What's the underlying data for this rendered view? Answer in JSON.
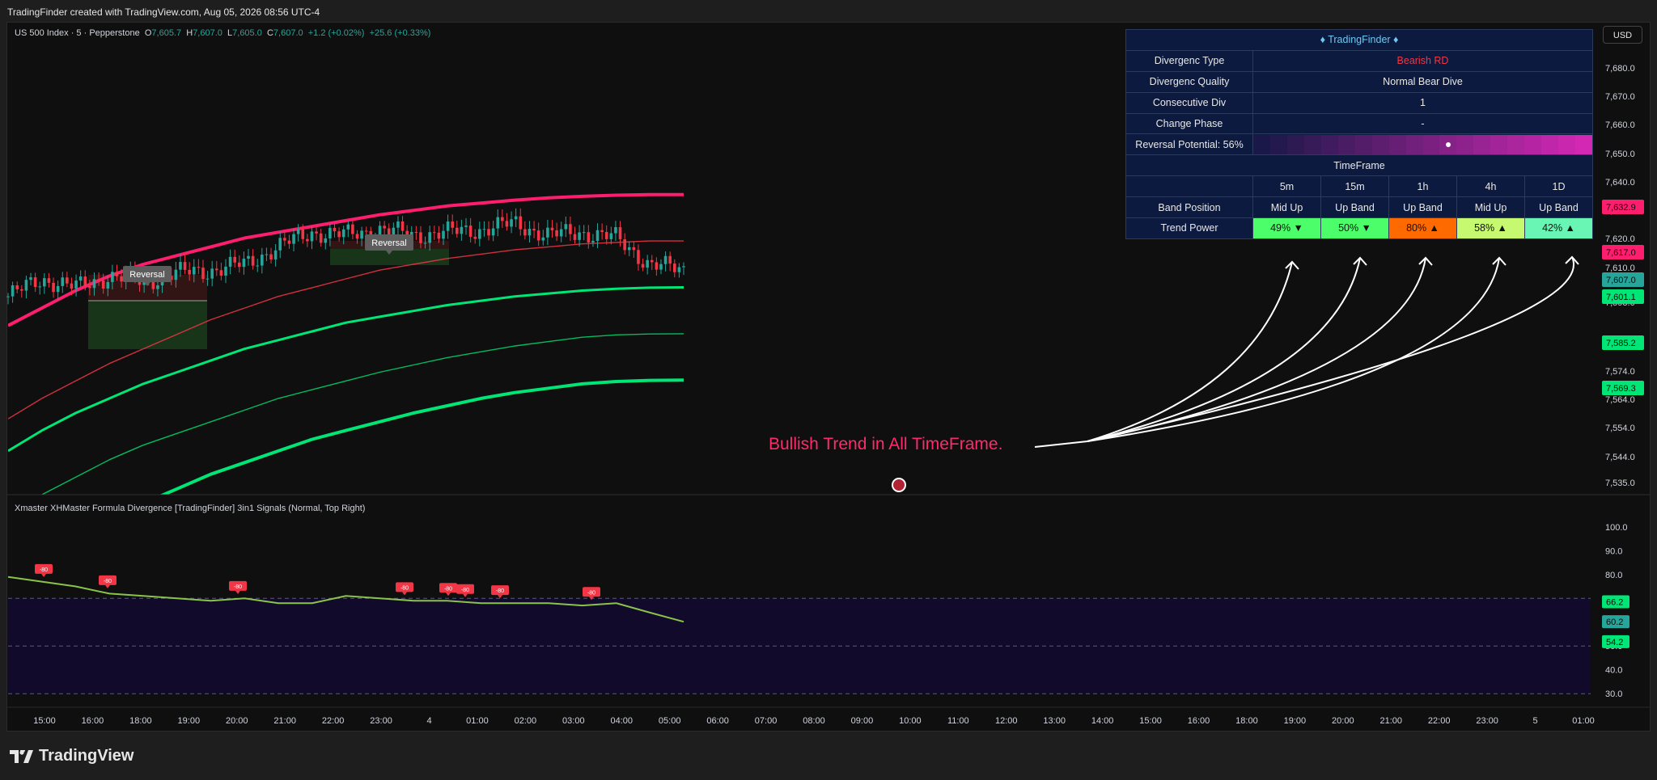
{
  "top_text": "TradingFinder created with TradingView.com, Aug 05, 2026 08:56 UTC-4",
  "brand": "TradingView",
  "currency_button": "USD",
  "symbol_header": {
    "name": "US 500 Index · 5 · Pepperstone",
    "o_label": "O",
    "o": "7,605.7",
    "h_label": "H",
    "h": "7,607.0",
    "l_label": "L",
    "l": "7,605.0",
    "c_label": "C",
    "c": "7,607.0",
    "change": "+1.2 (+0.02%)",
    "change2": "+25.6 (+0.33%)"
  },
  "indicator_header": "Xmaster XHMaster Formula Divergence [TradingFinder] 3in1 Signals (Normal, Top Right)",
  "annotation": "Bullish Trend in All TimeFrame.",
  "reversal_label": "Reversal",
  "signal_badge": "-80",
  "colors": {
    "bull": "#00e676",
    "bear": "#f23645",
    "pink": "#ff1e6e",
    "annotation": "#ff2a6e",
    "panel_bg": "#0c1a3f",
    "osc_zone": "#120a2a"
  },
  "table": {
    "title": "♦ TradingFinder ♦",
    "rows": [
      {
        "label": "Divergenc Type",
        "value": "Bearish RD",
        "value_color": "#f23645"
      },
      {
        "label": "Divergenc Quality",
        "value": "Normal Bear Dive"
      },
      {
        "label": "Consecutive Div",
        "value": "1"
      },
      {
        "label": "Change Phase",
        "value": "-"
      }
    ],
    "reversal_potential": {
      "label": "Reversal Potential: 56%",
      "value": 56
    },
    "timeframe_label": "TimeFrame",
    "timeframes": [
      "5m",
      "15m",
      "1h",
      "4h",
      "1D"
    ],
    "band_position": {
      "label": "Band Position",
      "values": [
        "Mid Up",
        "Up Band",
        "Up Band",
        "Mid Up",
        "Up Band"
      ]
    },
    "trend_power": {
      "label": "Trend Power",
      "values": [
        "49% ▼",
        "50% ▼",
        "80% ▲",
        "58% ▲",
        "42% ▲"
      ],
      "colors": [
        "#4cff6a",
        "#4cff6a",
        "#ff6a00",
        "#c6f870",
        "#69f5b3"
      ]
    }
  },
  "price_axis": {
    "ticks": [
      "7,680.0",
      "7,670.0",
      "7,660.0",
      "7,650.0",
      "7,640.0",
      "7,630.0",
      "7,620.0",
      "7,610.0",
      "7,598.0",
      "7,574.0",
      "7,564.0",
      "7,554.0",
      "7,544.0",
      "7,535.0"
    ],
    "badges": [
      {
        "text": "7,632.9",
        "color": "#ff1e6e"
      },
      {
        "text": "7,617.0",
        "color": "#ff1e6e"
      },
      {
        "text": "7,607.0",
        "color": "#26a69a"
      },
      {
        "text": "7,601.1",
        "color": "#00e676"
      },
      {
        "text": "7,585.2",
        "color": "#00e676"
      },
      {
        "text": "7,569.3",
        "color": "#00e676"
      }
    ]
  },
  "osc_axis": {
    "ticks": [
      "100.0",
      "90.0",
      "80.0",
      "70.0",
      "50.0",
      "40.0",
      "30.0"
    ],
    "badges": [
      {
        "text": "66.2",
        "color": "#00e676"
      },
      {
        "text": "60.2",
        "color": "#26a69a"
      },
      {
        "text": "54.2",
        "color": "#00e676"
      }
    ]
  },
  "time_axis": [
    "15:00",
    "16:00",
    "18:00",
    "19:00",
    "20:00",
    "21:00",
    "22:00",
    "23:00",
    "4",
    "01:00",
    "02:00",
    "03:00",
    "04:00",
    "05:00",
    "06:00",
    "07:00",
    "08:00",
    "09:00",
    "10:00",
    "11:00",
    "12:00",
    "13:00",
    "14:00",
    "15:00",
    "16:00",
    "18:00",
    "19:00",
    "20:00",
    "21:00",
    "22:00",
    "23:00",
    "5",
    "01:00"
  ],
  "chart_data": {
    "type": "line",
    "title": "US 500 Index · 5 · Pepperstone",
    "x_from": "15:00",
    "x_to": "05:30",
    "ylim": [
      7530,
      7688
    ],
    "x_positions": [
      0,
      0.05,
      0.1,
      0.15,
      0.2,
      0.25,
      0.3,
      0.35,
      0.4,
      0.45,
      0.5,
      0.55,
      0.6,
      0.65,
      0.7,
      0.75,
      0.8,
      0.85,
      0.9,
      0.95,
      1.0
    ],
    "series": [
      {
        "name": "",
        "color": "#ff1e6e",
        "values": [
          7588,
          7594,
          7600,
          7605,
          7609,
          7612,
          7615,
          7618,
          7620,
          7622,
          7624,
          7626,
          7627.5,
          7629,
          7630,
          7631,
          7631.8,
          7632.3,
          7632.7,
          7632.9,
          7632.9
        ]
      },
      {
        "name": "",
        "color": "#f23645",
        "values": [
          7556,
          7563,
          7569,
          7575,
          7580,
          7585,
          7590,
          7594,
          7598,
          7601,
          7604,
          7607,
          7609,
          7611,
          7612.5,
          7614,
          7615,
          7616,
          7616.5,
          7617,
          7617
        ]
      },
      {
        "name": "",
        "color": "#00e676",
        "values": [
          7545,
          7552,
          7558,
          7563,
          7568,
          7572,
          7576,
          7580,
          7583,
          7586,
          7589,
          7591,
          7593,
          7595,
          7596.5,
          7598,
          7599,
          7600,
          7600.6,
          7601,
          7601.1
        ]
      },
      {
        "name": "",
        "color": "#00e676",
        "values": [
          7524,
          7530,
          7536,
          7542,
          7547,
          7551,
          7555,
          7559,
          7563,
          7566,
          7569,
          7572,
          7574.5,
          7577,
          7579,
          7581,
          7582.5,
          7584,
          7584.8,
          7585.1,
          7585.2
        ]
      },
      {
        "name": "",
        "color": "#00e676",
        "values": [
          7500,
          7507,
          7514,
          7521,
          7527,
          7532,
          7537,
          7541,
          7545,
          7549,
          7552,
          7555,
          7558,
          7560.5,
          7563,
          7565,
          7566.5,
          7568,
          7568.8,
          7569.2,
          7569.3
        ]
      },
      {
        "name": "",
        "color": "#d1d4dc",
        "values": [
          7598,
          7604,
          7601,
          7605,
          7603,
          7606,
          7607,
          7609,
          7615,
          7620,
          7619,
          7621,
          7619,
          7620,
          7621,
          7623,
          7619,
          7620,
          7618,
          7609,
          7607
        ]
      }
    ],
    "oscillator": {
      "ylim": [
        26,
        104
      ],
      "levels": [
        70,
        50,
        30
      ],
      "values": [
        79,
        77,
        75,
        72,
        71,
        70,
        69,
        70,
        68,
        68,
        71,
        70,
        69,
        69,
        68,
        68,
        68,
        67,
        68,
        64,
        60.2
      ]
    }
  }
}
